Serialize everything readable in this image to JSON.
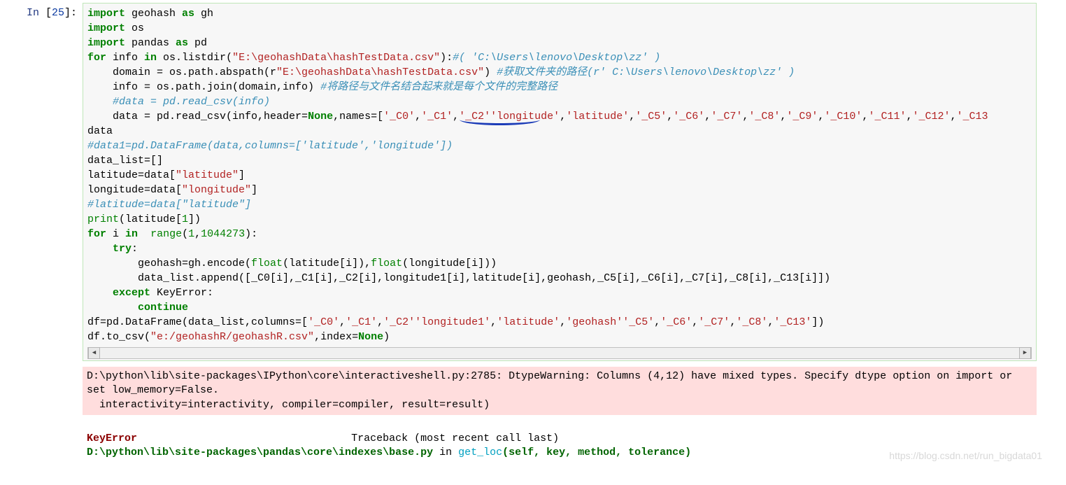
{
  "prompt": {
    "label": "In",
    "number": "25"
  },
  "code": {
    "tokens": [
      [
        [
          "kn",
          "import"
        ],
        [
          "nn",
          " geohash "
        ],
        [
          "kw",
          "as"
        ],
        [
          "nn",
          " gh"
        ]
      ],
      [
        [
          "kn",
          "import"
        ],
        [
          "nn",
          " os"
        ]
      ],
      [
        [
          "kn",
          "import"
        ],
        [
          "nn",
          " pandas "
        ],
        [
          "kw",
          "as"
        ],
        [
          "nn",
          " pd"
        ]
      ],
      [
        [
          "kw",
          "for"
        ],
        [
          "nn",
          " info "
        ],
        [
          "kw",
          "in"
        ],
        [
          "nn",
          " os.listdir("
        ],
        [
          "st",
          "\"E:\\geohashData\\hashTestData.csv\""
        ],
        [
          "nn",
          "):"
        ],
        [
          "cm",
          "#( 'C:\\Users\\lenovo\\Desktop\\zz' )"
        ]
      ],
      [
        [
          "nn",
          "    domain = os.path.abspath(r"
        ],
        [
          "st",
          "\"E:\\geohashData\\hashTestData.csv\""
        ],
        [
          "nn",
          ") "
        ],
        [
          "cm",
          "#获取文件夹的路径(r' C:\\Users\\lenovo\\Desktop\\zz' )"
        ]
      ],
      [
        [
          "nn",
          "    info = os.path.join(domain,info) "
        ],
        [
          "cm",
          "#将路径与文件名结合起来就是每个文件的完整路径"
        ]
      ],
      [
        [
          "nn",
          "    "
        ],
        [
          "cm",
          "#data = pd.read_csv(info)"
        ]
      ],
      [
        [
          "nn",
          "    data = pd.read_csv(info,header="
        ],
        [
          "const",
          "None"
        ],
        [
          "nn",
          ",names=["
        ],
        [
          "st",
          "'_C0'"
        ],
        [
          "nn",
          ","
        ],
        [
          "st",
          "'_C1'"
        ],
        [
          "nn",
          ","
        ],
        [
          "st",
          "'_C2'"
        ],
        [
          "st",
          "'longitude'"
        ],
        [
          "nn",
          ","
        ],
        [
          "st",
          "'latitude'"
        ],
        [
          "nn",
          ","
        ],
        [
          "st",
          "'_C5'"
        ],
        [
          "nn",
          ","
        ],
        [
          "st",
          "'_C6'"
        ],
        [
          "nn",
          ","
        ],
        [
          "st",
          "'_C7'"
        ],
        [
          "nn",
          ","
        ],
        [
          "st",
          "'_C8'"
        ],
        [
          "nn",
          ","
        ],
        [
          "st",
          "'_C9'"
        ],
        [
          "nn",
          ","
        ],
        [
          "st",
          "'_C10'"
        ],
        [
          "nn",
          ","
        ],
        [
          "st",
          "'_C11'"
        ],
        [
          "nn",
          ","
        ],
        [
          "st",
          "'_C12'"
        ],
        [
          "nn",
          ","
        ],
        [
          "st",
          "'_C13"
        ]
      ],
      [
        [
          "nn",
          "data"
        ]
      ],
      [
        [
          "cm",
          "#data1=pd.DataFrame(data,columns=['latitude','longitude'])"
        ]
      ],
      [
        [
          "nn",
          "data_list=[]"
        ]
      ],
      [
        [
          "nn",
          "latitude=data["
        ],
        [
          "st",
          "\"latitude\""
        ],
        [
          "nn",
          "]"
        ]
      ],
      [
        [
          "nn",
          "longitude=data["
        ],
        [
          "st",
          "\"longitude\""
        ],
        [
          "nn",
          "]"
        ]
      ],
      [
        [
          "cm",
          "#latitude=data[\"latitude\"]"
        ]
      ],
      [
        [
          "bi",
          "print"
        ],
        [
          "nn",
          "(latitude["
        ],
        [
          "num",
          "1"
        ],
        [
          "nn",
          "])"
        ]
      ],
      [
        [
          "kw",
          "for"
        ],
        [
          "nn",
          " i "
        ],
        [
          "kw",
          "in"
        ],
        [
          "nn",
          "  "
        ],
        [
          "bi",
          "range"
        ],
        [
          "nn",
          "("
        ],
        [
          "num",
          "1"
        ],
        [
          "nn",
          ","
        ],
        [
          "num",
          "1044273"
        ],
        [
          "nn",
          "):"
        ]
      ],
      [
        [
          "nn",
          "    "
        ],
        [
          "kw",
          "try"
        ],
        [
          "nn",
          ":"
        ]
      ],
      [
        [
          "nn",
          "        geohash=gh.encode("
        ],
        [
          "bi",
          "float"
        ],
        [
          "nn",
          "(latitude[i]),"
        ],
        [
          "bi",
          "float"
        ],
        [
          "nn",
          "(longitude[i]))"
        ]
      ],
      [
        [
          "nn",
          "        data_list.append([_C0[i],_C1[i],_C2[i],longitude1[i],latitude[i],geohash,_C5[i],_C6[i],_C7[i],_C8[i],_C13[i]])"
        ]
      ],
      [
        [
          "nn",
          "    "
        ],
        [
          "kw",
          "except"
        ],
        [
          "nn",
          " KeyError:"
        ]
      ],
      [
        [
          "nn",
          "        "
        ],
        [
          "kw",
          "continue"
        ]
      ],
      [
        [
          "nn",
          "df=pd.DataFrame(data_list,columns=["
        ],
        [
          "st",
          "'_C0'"
        ],
        [
          "nn",
          ","
        ],
        [
          "st",
          "'_C1'"
        ],
        [
          "nn",
          ","
        ],
        [
          "st",
          "'_C2'"
        ],
        [
          "st",
          "'longitude1'"
        ],
        [
          "nn",
          ","
        ],
        [
          "st",
          "'latitude'"
        ],
        [
          "nn",
          ","
        ],
        [
          "st",
          "'geohash'"
        ],
        [
          "st",
          "'_C5'"
        ],
        [
          "nn",
          ","
        ],
        [
          "st",
          "'_C6'"
        ],
        [
          "nn",
          ","
        ],
        [
          "st",
          "'_C7'"
        ],
        [
          "nn",
          ","
        ],
        [
          "st",
          "'_C8'"
        ],
        [
          "nn",
          ","
        ],
        [
          "st",
          "'_C13'"
        ],
        [
          "nn",
          "])"
        ]
      ],
      [
        [
          "nn",
          "df.to_csv("
        ],
        [
          "st",
          "\"e:/geohashR/geohashR.csv\""
        ],
        [
          "nn",
          ",index="
        ],
        [
          "const",
          "None"
        ],
        [
          "nn",
          ")"
        ]
      ]
    ]
  },
  "stderr": "D:\\python\\lib\\site-packages\\IPython\\core\\interactiveshell.py:2785: DtypeWarning: Columns (4,12) have mixed types. Specify dtype option on import or set low_memory=False.\n  interactivity=interactivity, compiler=compiler, result=result)",
  "traceback": {
    "ename": "KeyError",
    "label": "Traceback (most recent call last)",
    "line2_pre": "D:\\python\\lib\\site-packages\\pandas\\core\\indexes\\base.py",
    "line2_in": " in ",
    "line2_fn": "get_loc",
    "line2_args": "(self, key, method, tolerance)"
  },
  "watermark": "https://blog.csdn.net/run_bigdata01"
}
